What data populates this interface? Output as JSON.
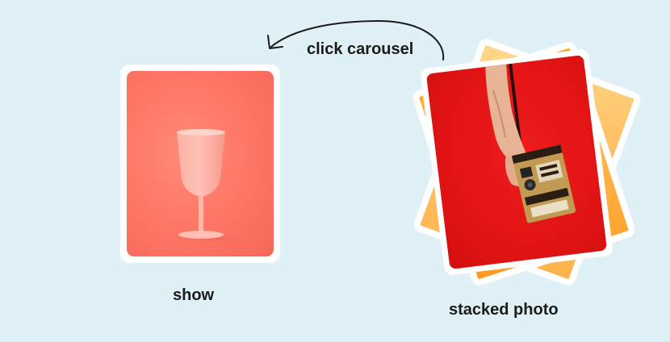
{
  "labels": {
    "show": "show",
    "stacked_photo": "stacked photo",
    "click_carousel": "click carousel"
  },
  "icons": {
    "arrow": "curved-arrow-icon",
    "glass": "wine-glass-icon",
    "camera": "instant-camera-icon"
  },
  "colors": {
    "background": "#dff0f7",
    "show_photo": "#ff7565",
    "stack_back": "#ffc266",
    "stack_mid": "#ff9f1a",
    "front_photo": "#e21414"
  }
}
